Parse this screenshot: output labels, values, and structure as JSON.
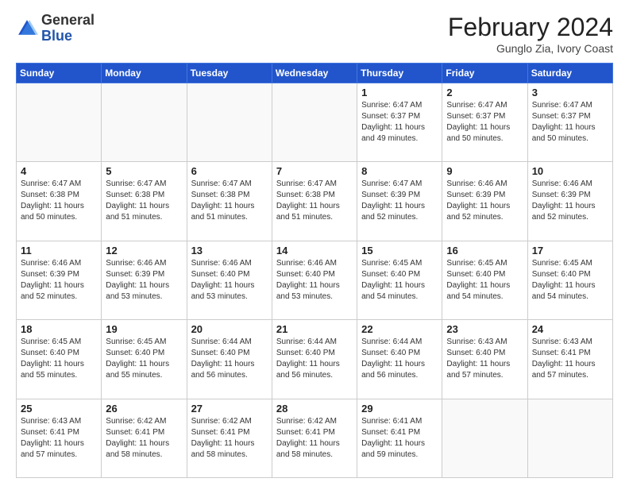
{
  "logo": {
    "general": "General",
    "blue": "Blue"
  },
  "header": {
    "month": "February 2024",
    "location": "Gunglo Zia, Ivory Coast"
  },
  "days_of_week": [
    "Sunday",
    "Monday",
    "Tuesday",
    "Wednesday",
    "Thursday",
    "Friday",
    "Saturday"
  ],
  "weeks": [
    [
      {
        "day": "",
        "info": ""
      },
      {
        "day": "",
        "info": ""
      },
      {
        "day": "",
        "info": ""
      },
      {
        "day": "",
        "info": ""
      },
      {
        "day": "1",
        "info": "Sunrise: 6:47 AM\nSunset: 6:37 PM\nDaylight: 11 hours and 49 minutes."
      },
      {
        "day": "2",
        "info": "Sunrise: 6:47 AM\nSunset: 6:37 PM\nDaylight: 11 hours and 50 minutes."
      },
      {
        "day": "3",
        "info": "Sunrise: 6:47 AM\nSunset: 6:37 PM\nDaylight: 11 hours and 50 minutes."
      }
    ],
    [
      {
        "day": "4",
        "info": "Sunrise: 6:47 AM\nSunset: 6:38 PM\nDaylight: 11 hours and 50 minutes."
      },
      {
        "day": "5",
        "info": "Sunrise: 6:47 AM\nSunset: 6:38 PM\nDaylight: 11 hours and 51 minutes."
      },
      {
        "day": "6",
        "info": "Sunrise: 6:47 AM\nSunset: 6:38 PM\nDaylight: 11 hours and 51 minutes."
      },
      {
        "day": "7",
        "info": "Sunrise: 6:47 AM\nSunset: 6:38 PM\nDaylight: 11 hours and 51 minutes."
      },
      {
        "day": "8",
        "info": "Sunrise: 6:47 AM\nSunset: 6:39 PM\nDaylight: 11 hours and 52 minutes."
      },
      {
        "day": "9",
        "info": "Sunrise: 6:46 AM\nSunset: 6:39 PM\nDaylight: 11 hours and 52 minutes."
      },
      {
        "day": "10",
        "info": "Sunrise: 6:46 AM\nSunset: 6:39 PM\nDaylight: 11 hours and 52 minutes."
      }
    ],
    [
      {
        "day": "11",
        "info": "Sunrise: 6:46 AM\nSunset: 6:39 PM\nDaylight: 11 hours and 52 minutes."
      },
      {
        "day": "12",
        "info": "Sunrise: 6:46 AM\nSunset: 6:39 PM\nDaylight: 11 hours and 53 minutes."
      },
      {
        "day": "13",
        "info": "Sunrise: 6:46 AM\nSunset: 6:40 PM\nDaylight: 11 hours and 53 minutes."
      },
      {
        "day": "14",
        "info": "Sunrise: 6:46 AM\nSunset: 6:40 PM\nDaylight: 11 hours and 53 minutes."
      },
      {
        "day": "15",
        "info": "Sunrise: 6:45 AM\nSunset: 6:40 PM\nDaylight: 11 hours and 54 minutes."
      },
      {
        "day": "16",
        "info": "Sunrise: 6:45 AM\nSunset: 6:40 PM\nDaylight: 11 hours and 54 minutes."
      },
      {
        "day": "17",
        "info": "Sunrise: 6:45 AM\nSunset: 6:40 PM\nDaylight: 11 hours and 54 minutes."
      }
    ],
    [
      {
        "day": "18",
        "info": "Sunrise: 6:45 AM\nSunset: 6:40 PM\nDaylight: 11 hours and 55 minutes."
      },
      {
        "day": "19",
        "info": "Sunrise: 6:45 AM\nSunset: 6:40 PM\nDaylight: 11 hours and 55 minutes."
      },
      {
        "day": "20",
        "info": "Sunrise: 6:44 AM\nSunset: 6:40 PM\nDaylight: 11 hours and 56 minutes."
      },
      {
        "day": "21",
        "info": "Sunrise: 6:44 AM\nSunset: 6:40 PM\nDaylight: 11 hours and 56 minutes."
      },
      {
        "day": "22",
        "info": "Sunrise: 6:44 AM\nSunset: 6:40 PM\nDaylight: 11 hours and 56 minutes."
      },
      {
        "day": "23",
        "info": "Sunrise: 6:43 AM\nSunset: 6:40 PM\nDaylight: 11 hours and 57 minutes."
      },
      {
        "day": "24",
        "info": "Sunrise: 6:43 AM\nSunset: 6:41 PM\nDaylight: 11 hours and 57 minutes."
      }
    ],
    [
      {
        "day": "25",
        "info": "Sunrise: 6:43 AM\nSunset: 6:41 PM\nDaylight: 11 hours and 57 minutes."
      },
      {
        "day": "26",
        "info": "Sunrise: 6:42 AM\nSunset: 6:41 PM\nDaylight: 11 hours and 58 minutes."
      },
      {
        "day": "27",
        "info": "Sunrise: 6:42 AM\nSunset: 6:41 PM\nDaylight: 11 hours and 58 minutes."
      },
      {
        "day": "28",
        "info": "Sunrise: 6:42 AM\nSunset: 6:41 PM\nDaylight: 11 hours and 58 minutes."
      },
      {
        "day": "29",
        "info": "Sunrise: 6:41 AM\nSunset: 6:41 PM\nDaylight: 11 hours and 59 minutes."
      },
      {
        "day": "",
        "info": ""
      },
      {
        "day": "",
        "info": ""
      }
    ]
  ]
}
